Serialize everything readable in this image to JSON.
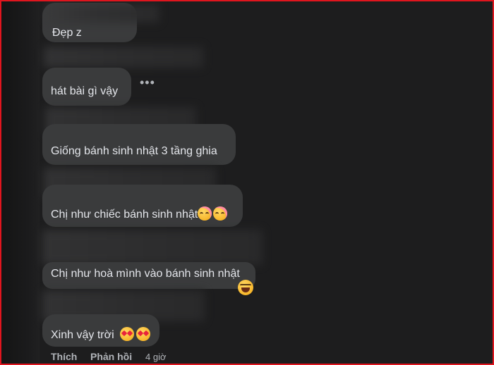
{
  "comments": [
    {
      "text": "Đẹp z"
    },
    {
      "text": "hát bài gì vậy"
    },
    {
      "text": "Giống bánh sinh nhật 3 tầng ghia"
    },
    {
      "text": "Chị như chiếc bánh sinh nhật"
    },
    {
      "text": "Chị như hoà mình vào bánh sinh nhật"
    },
    {
      "text": "Xinh vậy trời"
    }
  ],
  "more_icon": "ellipsis-icon",
  "actions": {
    "like_label": "Thích",
    "reply_label": "Phản hồi",
    "timestamp": "4 giờ"
  },
  "colors": {
    "background": "#1d1d1e",
    "bubble": "#3a3b3c",
    "text": "#e4e6eb",
    "muted": "#b0b3b8",
    "frame": "#e0151e"
  }
}
